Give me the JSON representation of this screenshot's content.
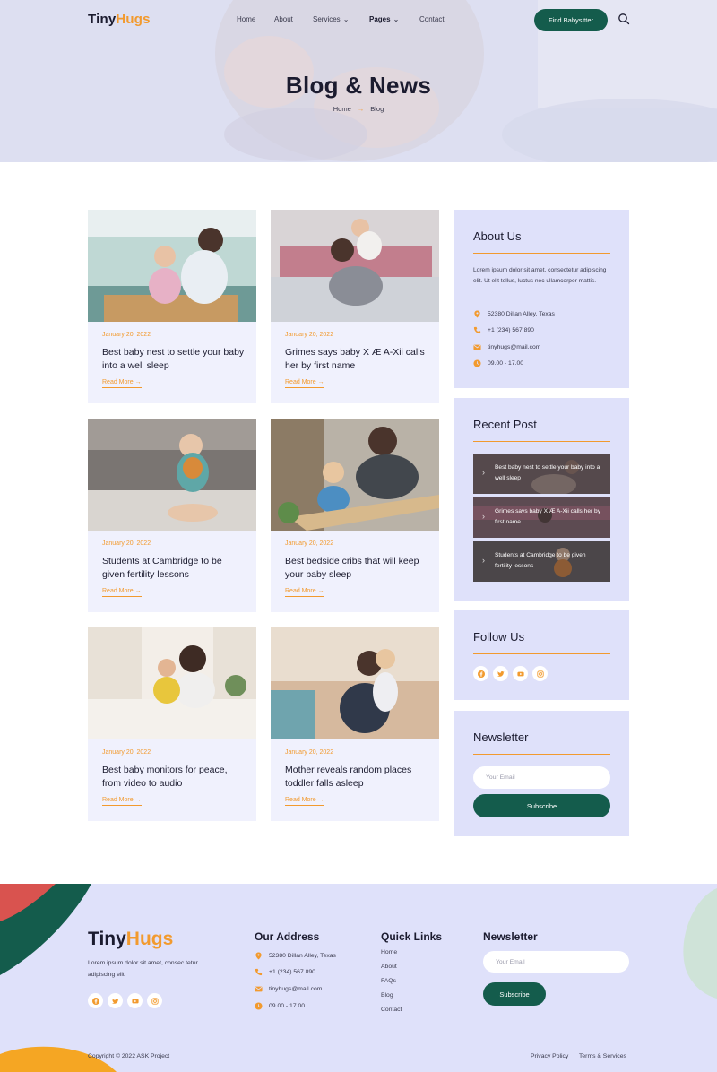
{
  "brand": {
    "part1": "Tiny",
    "part2": "Hugs"
  },
  "nav": {
    "items": [
      {
        "label": "Home"
      },
      {
        "label": "About"
      },
      {
        "label": "Services"
      },
      {
        "label": "Pages"
      },
      {
        "label": "Contact"
      }
    ],
    "cta_label": "Find Babysitter"
  },
  "hero": {
    "title": "Blog & News",
    "breadcrumb": {
      "home": "Home",
      "separator": "→",
      "current": "Blog"
    }
  },
  "posts": [
    {
      "date": "January 20, 2022",
      "title": "Best baby nest to settle your baby into a well sleep",
      "link": "Read More →"
    },
    {
      "date": "January 20, 2022",
      "title": "Grimes says baby X Æ A-Xii calls her by first name",
      "link": "Read More →"
    },
    {
      "date": "January 20, 2022",
      "title": "Students at Cambridge to be given fertility lessons",
      "link": "Read More →"
    },
    {
      "date": "January 20, 2022",
      "title": "Best bedside cribs that will keep your baby sleep",
      "link": "Read More →"
    },
    {
      "date": "January 20, 2022",
      "title": "Best baby monitors for peace, from video to audio",
      "link": "Read More →"
    },
    {
      "date": "January 20, 2022",
      "title": "Mother reveals random places toddler falls asleep",
      "link": "Read More →"
    }
  ],
  "sidebar": {
    "about": {
      "title": "About Us",
      "text": "Lorem ipsum dolor sit amet, consectetur adipiscing elit. Ut elit tellus, luctus nec ullamcorper mattis.",
      "address": "52380 Dillan Alley, Texas",
      "phone": "+1 (234) 567 890",
      "email": "tinyhugs@mail.com",
      "hours": "09.00 - 17.00"
    },
    "recent": {
      "title": "Recent Post",
      "items": [
        {
          "title": "Best baby nest to settle your baby into a well sleep"
        },
        {
          "title": "Grimes says baby X Æ A-Xii calls her by first name"
        },
        {
          "title": "Students at Cambridge to be given fertility lessons"
        }
      ]
    },
    "follow": {
      "title": "Follow Us",
      "icons": [
        "facebook-icon",
        "twitter-icon",
        "youtube-icon",
        "instagram-icon"
      ]
    },
    "newsletter": {
      "title": "Newsletter",
      "placeholder": "Your Email",
      "button": "Subscribe"
    }
  },
  "footer": {
    "desc": "Lorem ipsum dolor sit amet, consec tetur adipiscing elit.",
    "address": {
      "title": "Our Address",
      "street": "52380 Dillan Alley, Texas",
      "phone": "+1 (234) 567 890",
      "email": "tinyhugs@mail.com",
      "hours": "09.00 - 17.00"
    },
    "quick_links": {
      "title": "Quick Links",
      "items": [
        "Home",
        "About",
        "FAQs",
        "Blog",
        "Contact"
      ]
    },
    "newsletter": {
      "title": "Newsletter",
      "placeholder": "Your Email",
      "button": "Subscribe"
    },
    "copyright": "Copyright © 2022 ASK Project",
    "privacy": "Privacy Policy",
    "terms": "Terms & Services"
  },
  "colors": {
    "accent": "#f29a2e",
    "primary": "#145c4c",
    "card_bg": "#f0f1fd",
    "widget_bg": "#dfe1fa"
  }
}
